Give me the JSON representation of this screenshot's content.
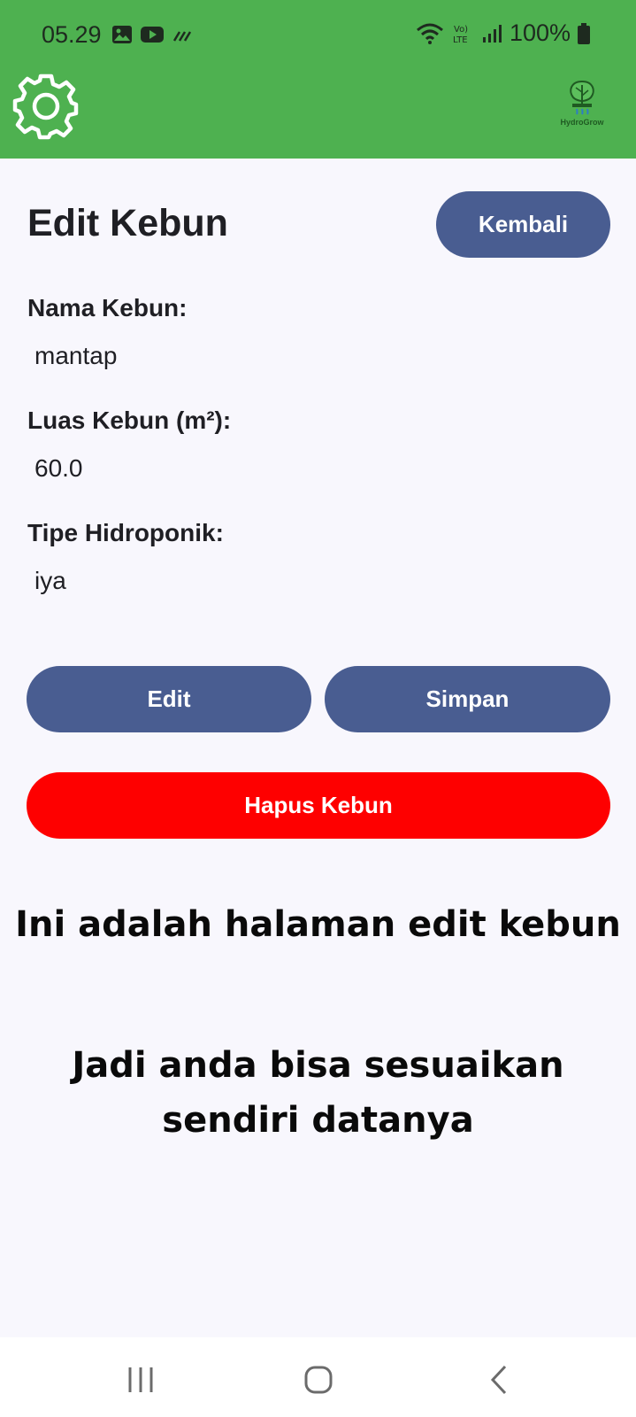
{
  "status_bar": {
    "time": "05.29",
    "battery_pct": "100%",
    "icons_left": [
      "gallery-icon",
      "youtube-icon",
      "activity-icon"
    ],
    "icons_right": [
      "wifi-icon",
      "volte-icon",
      "signal-icon",
      "battery-icon"
    ]
  },
  "app_bar": {
    "settings_icon": "gear-icon",
    "logo_text": "HydroGrow"
  },
  "page": {
    "title": "Edit Kebun",
    "back_label": "Kembali"
  },
  "form": {
    "nama_label": "Nama Kebun:",
    "nama_value": "mantap",
    "luas_label": "Luas Kebun (m²):",
    "luas_value": "60.0",
    "tipe_label": "Tipe Hidroponik:",
    "tipe_value": "iya"
  },
  "actions": {
    "edit_label": "Edit",
    "save_label": "Simpan",
    "delete_label": "Hapus Kebun"
  },
  "caption": {
    "line1": "Ini adalah halaman edit kebun",
    "line2a": "Jadi anda bisa sesuaikan",
    "line2b": "sendiri datanya"
  },
  "colors": {
    "app_bar": "#4eb150",
    "primary_button": "#495d91",
    "danger_button": "#fe0000",
    "background": "#f8f7fd"
  }
}
